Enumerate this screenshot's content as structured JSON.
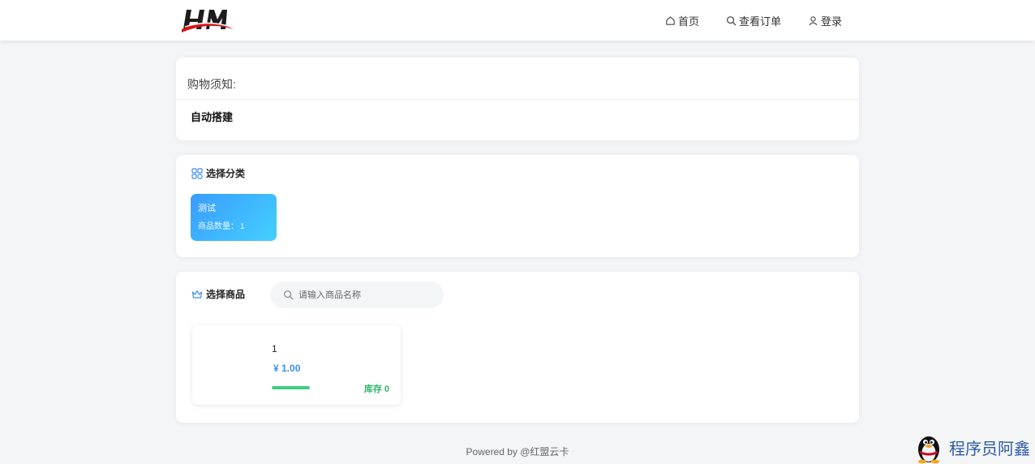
{
  "header": {
    "logo_text": "HM",
    "nav": [
      {
        "label": "首页",
        "icon": "home-icon"
      },
      {
        "label": "查看订单",
        "icon": "search-icon"
      },
      {
        "label": "登录",
        "icon": "user-icon"
      }
    ]
  },
  "notice": {
    "title": "购物须知:",
    "body": "自动搭建"
  },
  "category_section": {
    "title": "选择分类",
    "icon": "grid-icon",
    "items": [
      {
        "name": "测试",
        "count_label": "商品数量：",
        "count": "1"
      }
    ]
  },
  "goods_section": {
    "title": "选择商品",
    "icon": "crown-icon",
    "search_placeholder": "请输入商品名称",
    "products": [
      {
        "name": "1",
        "price": "¥ 1.00",
        "stock_label": "库存",
        "stock": "0",
        "stock_fraction": 1.0
      }
    ]
  },
  "footer": {
    "text": "Powered by @红盟云卡"
  },
  "watermark": {
    "text": "程序员阿鑫",
    "icon": "qq-penguin-icon"
  },
  "colors": {
    "accent_blue": "#3d8ef0",
    "tile_gradient_start": "#3a9cff",
    "tile_gradient_end": "#43d0ff",
    "stock_green": "#2fb86a"
  }
}
